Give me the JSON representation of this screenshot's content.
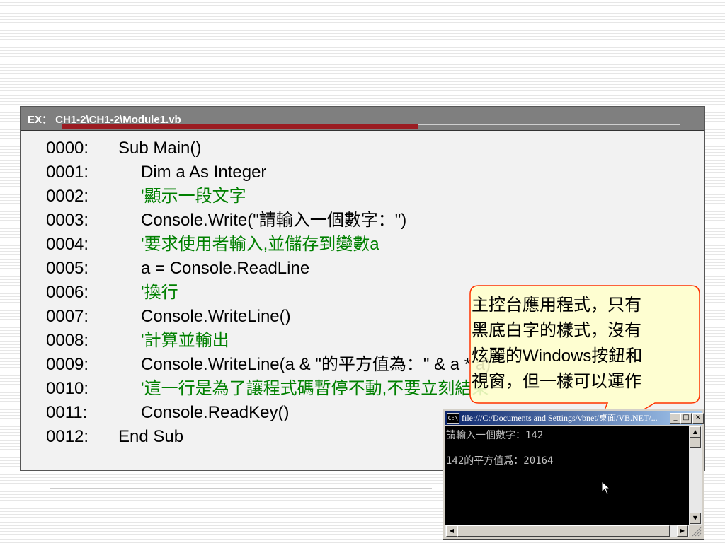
{
  "header": {
    "title": "EX： CH1-2\\CH1-2\\Module1.vb"
  },
  "code": [
    {
      "num": "0000:",
      "text": "Sub Main()",
      "indent": 0,
      "comment": false
    },
    {
      "num": "0001:",
      "text": "Dim a As Integer",
      "indent": 1,
      "comment": false
    },
    {
      "num": "0002:",
      "text": "'顯示一段文字",
      "indent": 1,
      "comment": true
    },
    {
      "num": "0003:",
      "text": "Console.Write(\"請輸入一個數字：\")",
      "indent": 1,
      "comment": false
    },
    {
      "num": "0004:",
      "text": "'要求使用者輸入,並儲存到變數a",
      "indent": 1,
      "comment": true
    },
    {
      "num": "0005:",
      "text": "a = Console.ReadLine",
      "indent": 1,
      "comment": false
    },
    {
      "num": "0006:",
      "text": "'換行",
      "indent": 1,
      "comment": true
    },
    {
      "num": "0007:",
      "text": "Console.WriteLine()",
      "indent": 1,
      "comment": false
    },
    {
      "num": "0008:",
      "text": "'計算並輸出",
      "indent": 1,
      "comment": true
    },
    {
      "num": "0009:",
      "text": "Console.WriteLine(a & \"的平方值為：\" & a * a)",
      "indent": 1,
      "comment": false
    },
    {
      "num": "0010:",
      "text": "'這一行是為了讓程式碼暫停不動,不要立刻結束",
      "indent": 1,
      "comment": true
    },
    {
      "num": "0011:",
      "text": "Console.ReadKey()",
      "indent": 1,
      "comment": false
    },
    {
      "num": "0012:",
      "text": "End Sub",
      "indent": 0,
      "comment": false
    }
  ],
  "callout": {
    "lines": [
      "主控台應用程式，只有",
      "黑底白字的樣式，沒有",
      "炫麗的Windows按鈕和",
      "視窗，但一樣可以運作"
    ]
  },
  "console": {
    "icon_text": "C:\\",
    "title": "file:///C:/Documents and Settings/vbnet/桌面/VB.NET/...",
    "minimize_label": "_",
    "maximize_label": "□",
    "close_label": "×",
    "lines": [
      "請輸入一個數字：142",
      "",
      "142的平方值爲：20164"
    ]
  },
  "colors": {
    "comment": "#008000",
    "header_bg": "#7f7f7f",
    "header_accent": "#9b1c22",
    "callout_fill": "#ffffcc",
    "callout_stroke": "#ff3300"
  }
}
